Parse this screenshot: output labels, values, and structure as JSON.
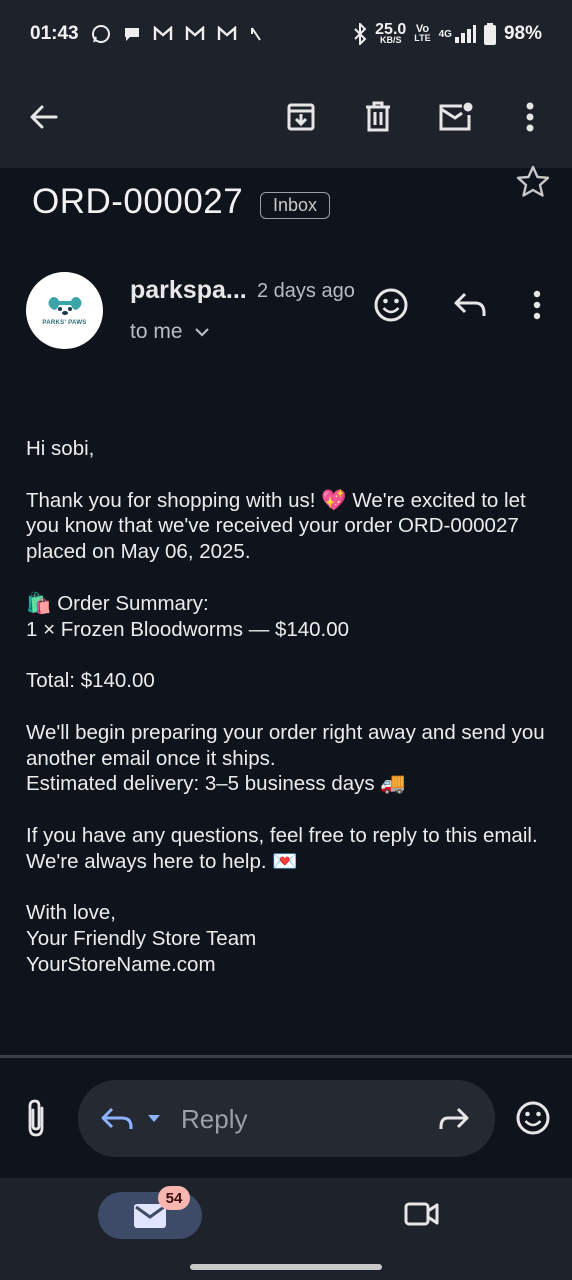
{
  "status": {
    "time": "01:43",
    "speed_value": "25.0",
    "speed_unit": "KB/S",
    "volte_top": "Vo",
    "volte_bottom": "LTE",
    "network": "4G",
    "battery": "98%"
  },
  "appbar": {
    "back_icon": "arrow-left-icon",
    "archive_icon": "archive-icon",
    "delete_icon": "trash-icon",
    "mark_unread_icon": "mail-unread-icon",
    "more_icon": "more-vert-icon"
  },
  "email": {
    "subject": "ORD-000027",
    "label": "Inbox",
    "sender": "parkspa...",
    "date": "2 days ago",
    "recipient": "to me",
    "avatar_text": "PARKS' PAWS",
    "body": {
      "greeting": "Hi sobi,",
      "p1": "Thank you for shopping with us! 💖 We're excited to let you know that we've received your order ORD-000027 placed on May 06, 2025.",
      "summary_title": "🛍️ Order Summary:",
      "summary_item": "1 × Frozen Bloodworms — $140.00",
      "total": "Total: $140.00",
      "p3_line1": "We'll begin preparing your order right away and send you another email once it ships.",
      "p3_line2": "Estimated delivery: 3–5 business days 🚚",
      "p4_line1": "If you have any questions, feel free to reply to this email.",
      "p4_line2": "We're always here to help. 💌",
      "sign1": "With love,",
      "sign2": "Your Friendly Store Team",
      "sign3": "YourStoreName.com"
    }
  },
  "reply_bar": {
    "placeholder": "Reply"
  },
  "bottom_nav": {
    "mail_badge": "54"
  }
}
